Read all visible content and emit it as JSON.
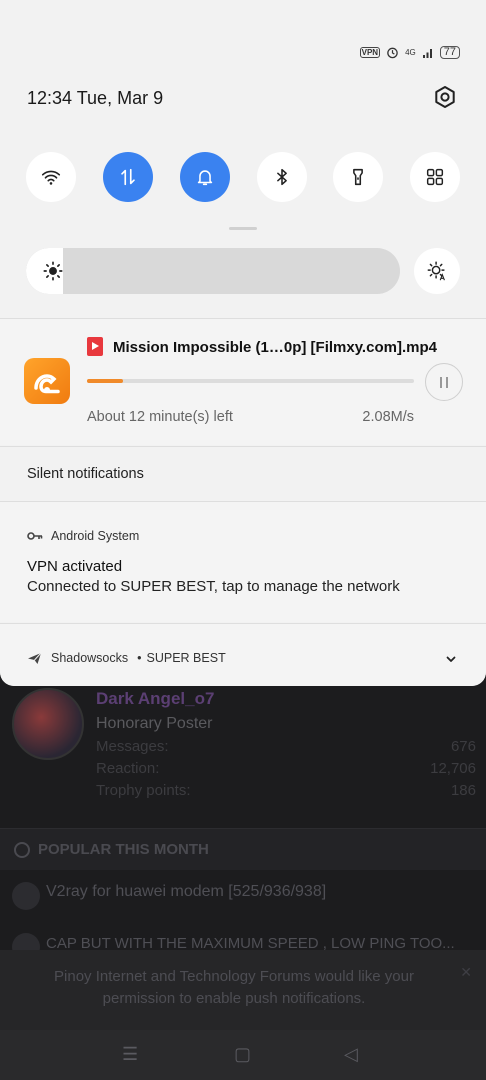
{
  "status_bar": {
    "vpn_label": "VPN",
    "network_label": "4G",
    "battery": "77"
  },
  "header": {
    "time_date": "12:34  Tue, Mar 9"
  },
  "quick_settings": [
    {
      "name": "wifi",
      "icon": "wifi-icon",
      "on": false
    },
    {
      "name": "mobile-data",
      "icon": "data-arrows-icon",
      "on": true
    },
    {
      "name": "sound",
      "icon": "bell-icon",
      "on": true
    },
    {
      "name": "bluetooth",
      "icon": "bluetooth-icon",
      "on": false
    },
    {
      "name": "flashlight",
      "icon": "flashlight-icon",
      "on": false
    },
    {
      "name": "more",
      "icon": "grid-icon",
      "on": false
    }
  ],
  "brightness": {
    "level": 0.1
  },
  "download": {
    "app_icon": "uc-browser-icon",
    "title": "Mission Impossible (1…0p] [Filmxy.com].mp4",
    "progress": 0.11,
    "eta": "About 12 minute(s) left",
    "speed": "2.08M/s"
  },
  "silent_header": "Silent notifications",
  "system_notification": {
    "app": "Android System",
    "title": "VPN activated",
    "body": "Connected to SUPER BEST, tap to manage the network"
  },
  "shadowsocks_notification": {
    "app": "Shadowsocks",
    "separator": "•",
    "profile": "SUPER BEST"
  },
  "background_page": {
    "username": "Dark Angel_o7",
    "role": "Honorary Poster",
    "stats": [
      {
        "label": "Messages:",
        "value": "676"
      },
      {
        "label": "Reaction:",
        "value": "12,706"
      },
      {
        "label": "Trophy points:",
        "value": "186"
      }
    ],
    "popular_title": "POPULAR THIS MONTH",
    "threads": [
      "V2ray for huawei modem [525/936/938]",
      "CAP BUT WITH THE MAXIMUM SPEED , LOW PING TOO..."
    ],
    "push_prompt": "Pinoy Internet and Technology Forums would like your permission to enable push notifications.",
    "push_close": "✕"
  },
  "nav_bar": {
    "menu_glyph": "☰",
    "home_glyph": "▢",
    "back_glyph": "◁"
  },
  "colors": {
    "accent": "#3a82f0",
    "progress": "#f08a2a",
    "shade_bg": "#f2f2f2"
  }
}
